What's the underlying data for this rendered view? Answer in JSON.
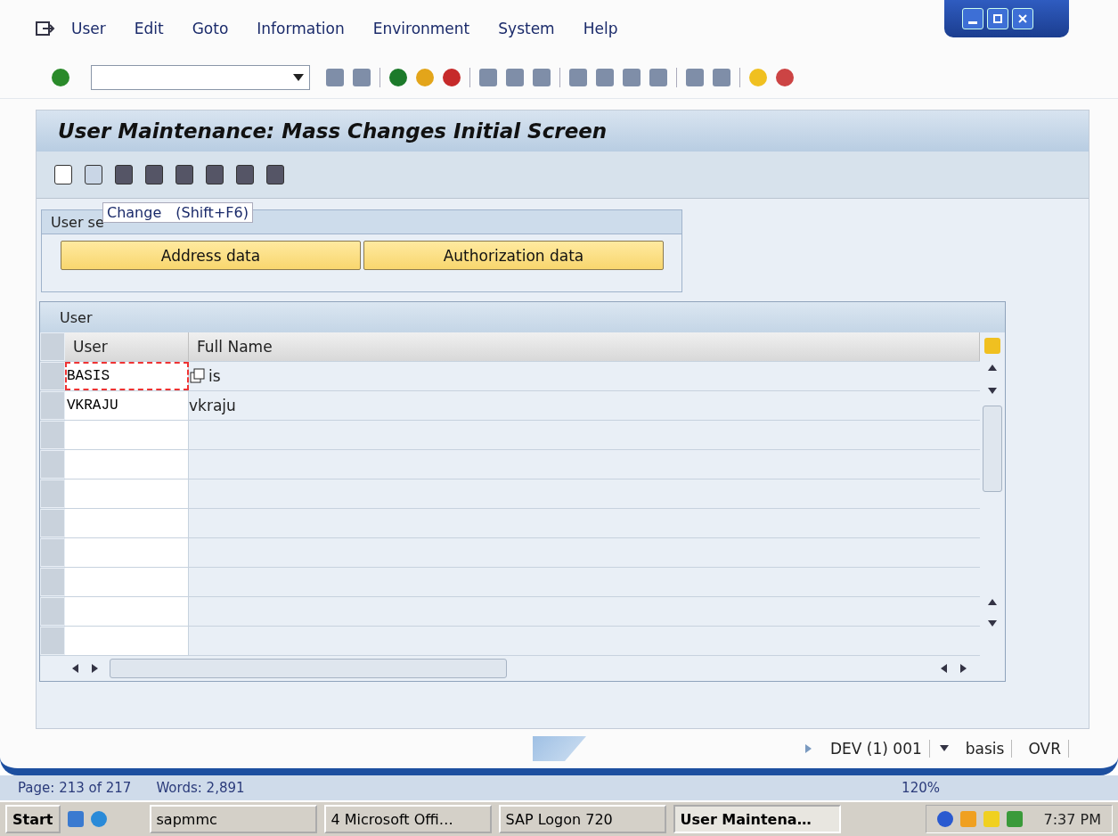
{
  "menu": [
    "User",
    "Edit",
    "Goto",
    "Information",
    "Environment",
    "System",
    "Help"
  ],
  "screen_title": "User Maintenance: Mass Changes Initial Screen",
  "tooltip": {
    "label": "Change",
    "shortcut": "(Shift+F6)"
  },
  "group": {
    "title": "User se",
    "buttons": [
      "Address data",
      "Authorization data"
    ]
  },
  "table": {
    "title": "User",
    "columns": [
      "User",
      "Full Name"
    ],
    "rows": [
      {
        "user": "BASIS",
        "full_name": "is",
        "focused": true
      },
      {
        "user": "VKRAJU",
        "full_name": "vkraju",
        "focused": false
      }
    ]
  },
  "status_bar": {
    "system": "DEV (1) 001",
    "user": "basis",
    "mode": "OVR"
  },
  "word_status": {
    "page": "Page: 213 of 217",
    "words": "Words: 2,891",
    "zoom": "120%"
  },
  "taskbar": {
    "start": "Start",
    "clock": "7:37 PM",
    "items": [
      {
        "label": "sapmmc",
        "selected": false
      },
      {
        "label": "4 Microsoft Offi…",
        "selected": false
      },
      {
        "label": "SAP Logon 720",
        "selected": false
      },
      {
        "label": "User Maintena…",
        "selected": true
      }
    ]
  }
}
